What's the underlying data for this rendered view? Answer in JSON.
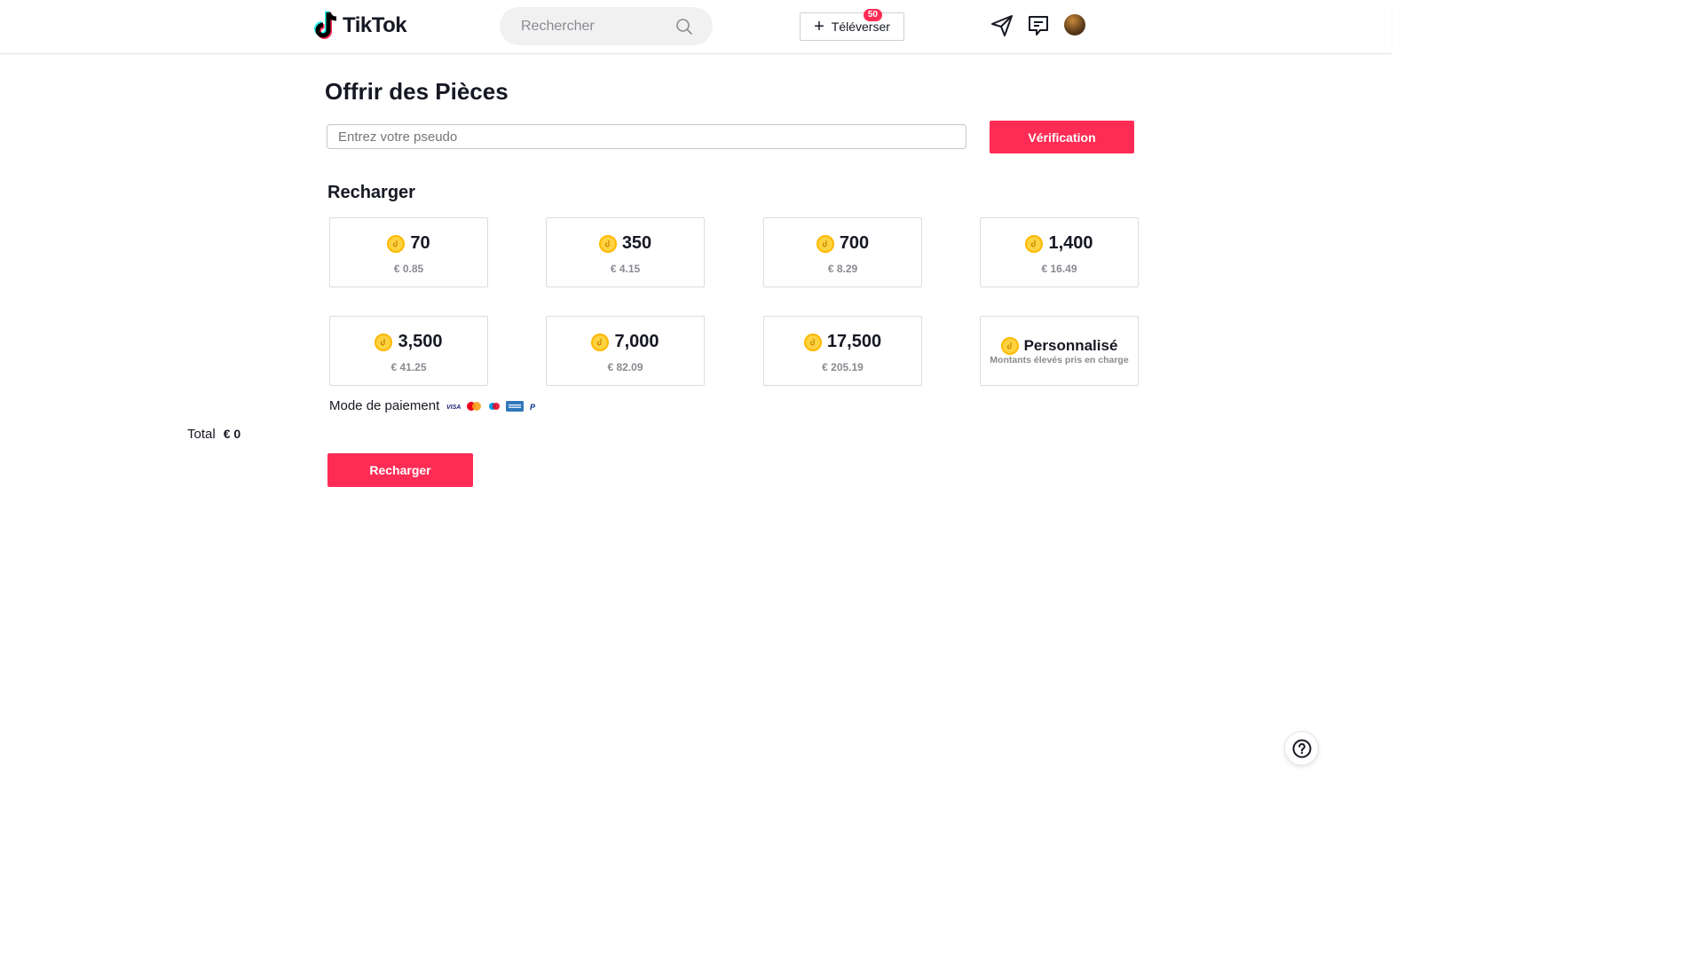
{
  "header": {
    "logo_text": "TikTok",
    "search_placeholder": "Rechercher",
    "upload_label": "Téléverser",
    "upload_badge": "50"
  },
  "page": {
    "title": "Offrir des Pièces",
    "pseudo_placeholder": "Entrez votre pseudo",
    "verify_label": "Vérification",
    "recharge_title": "Recharger"
  },
  "packages": [
    {
      "amount": "70",
      "price": "€ 0.85"
    },
    {
      "amount": "350",
      "price": "€ 4.15"
    },
    {
      "amount": "700",
      "price": "€ 8.29"
    },
    {
      "amount": "1,400",
      "price": "€ 16.49"
    },
    {
      "amount": "3,500",
      "price": "€ 41.25"
    },
    {
      "amount": "7,000",
      "price": "€ 82.09"
    },
    {
      "amount": "17,500",
      "price": "€ 205.19"
    }
  ],
  "custom_package": {
    "label": "Personnalisé",
    "sub": "Montants élevés pris en charge"
  },
  "payment": {
    "label": "Mode de paiement",
    "methods": [
      "visa",
      "mastercard",
      "maestro",
      "amex",
      "paypal"
    ]
  },
  "total": {
    "label": "Total",
    "value": "€ 0"
  },
  "recharge_button": "Recharger",
  "colors": {
    "accent": "#fe2c55",
    "coin": "#ffd23f"
  }
}
